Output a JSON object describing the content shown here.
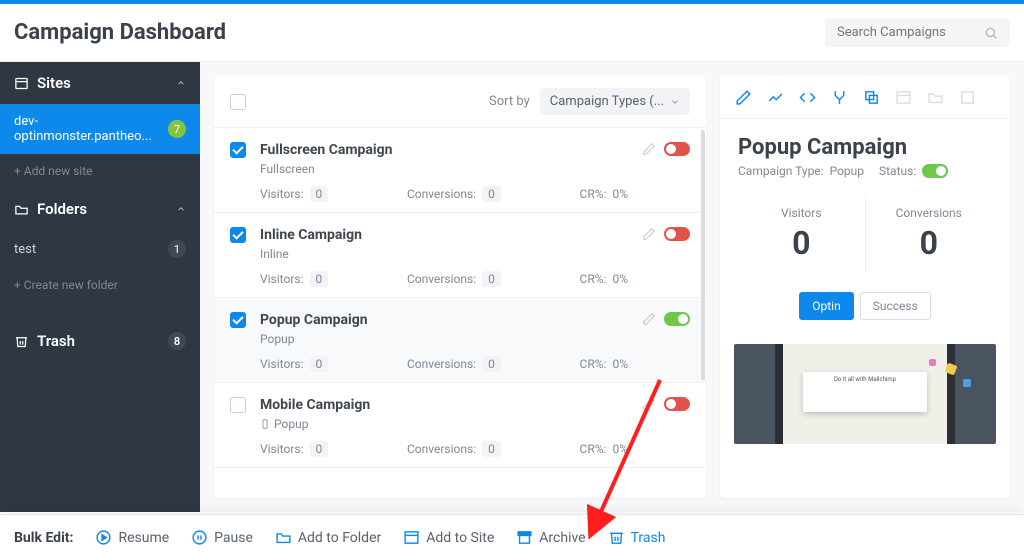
{
  "header": {
    "title": "Campaign Dashboard",
    "search_placeholder": "Search Campaigns"
  },
  "sidebar": {
    "sites_label": "Sites",
    "site_name": "dev-optinmonster.pantheo...",
    "site_count": "7",
    "add_site": "+ Add new site",
    "folders_label": "Folders",
    "folder_name": "test",
    "folder_count": "1",
    "add_folder": "+ Create new folder",
    "trash_label": "Trash",
    "trash_count": "8"
  },
  "list": {
    "sort_label": "Sort by",
    "sort_value": "Campaign Types (...",
    "rows": [
      {
        "title": "Fullscreen Campaign",
        "subtitle": "Fullscreen",
        "visitors_lbl": "Visitors:",
        "visitors": "0",
        "conv_lbl": "Conversions:",
        "conv": "0",
        "cr_lbl": "CR%:",
        "cr": "0%",
        "checked": true,
        "on": false
      },
      {
        "title": "Inline Campaign",
        "subtitle": "Inline",
        "visitors_lbl": "Visitors:",
        "visitors": "0",
        "conv_lbl": "Conversions:",
        "conv": "0",
        "cr_lbl": "CR%:",
        "cr": "0%",
        "checked": true,
        "on": false
      },
      {
        "title": "Popup Campaign",
        "subtitle": "Popup",
        "visitors_lbl": "Visitors:",
        "visitors": "0",
        "conv_lbl": "Conversions:",
        "conv": "0",
        "cr_lbl": "CR%:",
        "cr": "0%",
        "checked": true,
        "on": true
      },
      {
        "title": "Mobile Campaign",
        "subtitle": "Popup",
        "visitors_lbl": "Visitors:",
        "visitors": "0",
        "conv_lbl": "Conversions:",
        "conv": "0",
        "cr_lbl": "CR%:",
        "cr": "0%",
        "checked": false,
        "on": false,
        "mobile": true
      }
    ]
  },
  "detail": {
    "title": "Popup Campaign",
    "type_label": "Campaign Type:",
    "type_value": "Popup",
    "status_label": "Status:",
    "visitors_label": "Visitors",
    "visitors_value": "0",
    "conversions_label": "Conversions",
    "conversions_value": "0",
    "optin_btn": "Optin",
    "success_btn": "Success"
  },
  "bulk": {
    "label": "Bulk Edit:",
    "resume": "Resume",
    "pause": "Pause",
    "add_folder": "Add to Folder",
    "add_site": "Add to Site",
    "archive": "Archive",
    "trash": "Trash"
  }
}
